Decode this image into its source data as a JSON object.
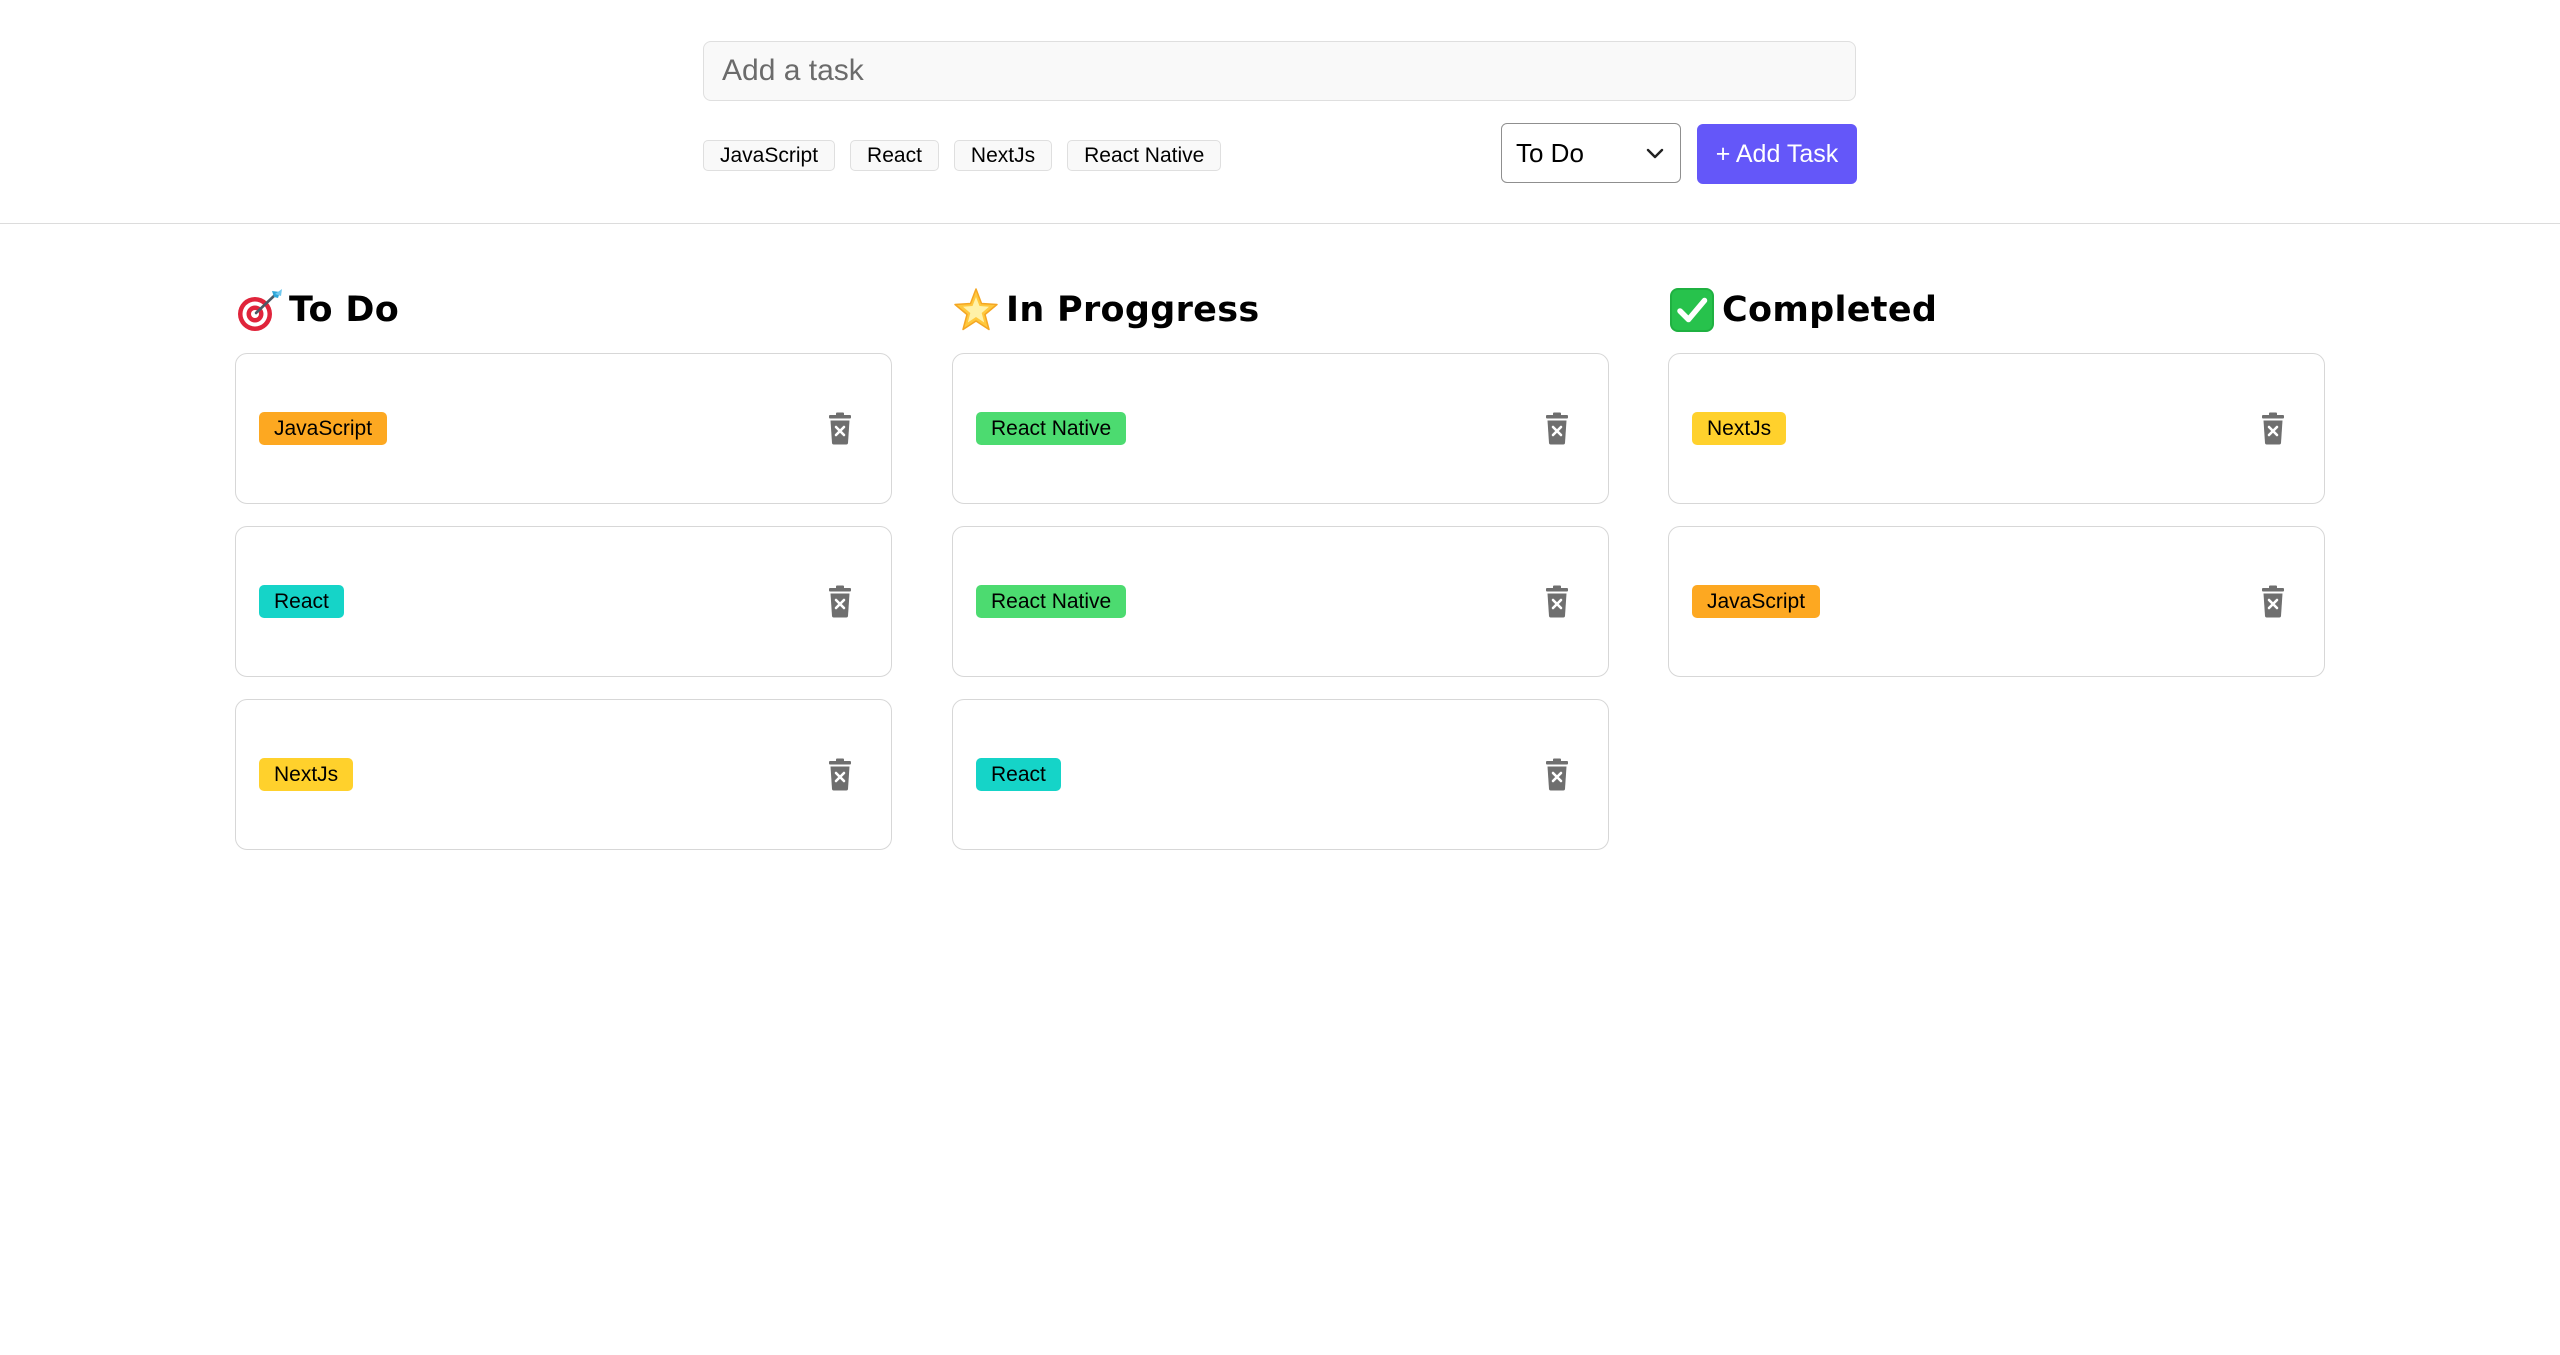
{
  "form": {
    "task_input_placeholder": "Add a task",
    "task_input_value": "",
    "tags": [
      {
        "label": "JavaScript"
      },
      {
        "label": "React"
      },
      {
        "label": "NextJs"
      },
      {
        "label": "React Native"
      }
    ],
    "status_select": {
      "selected": "To Do",
      "options": [
        "To Do",
        "In Proggress",
        "Completed"
      ]
    },
    "add_button_label": "+ Add Task",
    "add_button_color": "#6457f9"
  },
  "tag_colors": {
    "JavaScript": "#fda821",
    "React": "#15d4c8",
    "NextJs": "#ffd12c",
    "React Native": "#4cdb70"
  },
  "columns": [
    {
      "title": "To Do",
      "icon": "direct-hit-icon",
      "cards": [
        {
          "tag": "JavaScript"
        },
        {
          "tag": "React"
        },
        {
          "tag": "NextJs"
        }
      ]
    },
    {
      "title": "In Proggress",
      "icon": "glowing-star-icon",
      "cards": [
        {
          "tag": "React Native"
        },
        {
          "tag": "React Native"
        },
        {
          "tag": "React"
        }
      ]
    },
    {
      "title": "Completed",
      "icon": "check-mark-button-icon",
      "cards": [
        {
          "tag": "NextJs"
        },
        {
          "tag": "JavaScript"
        }
      ]
    }
  ]
}
